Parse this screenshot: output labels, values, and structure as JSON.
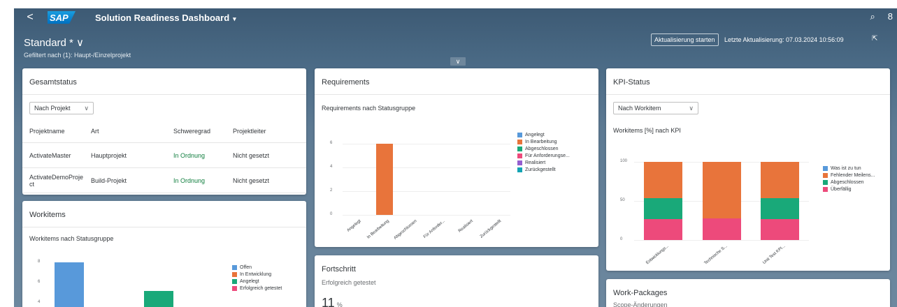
{
  "shell": {
    "back": "<",
    "logo": "SAP",
    "app_title": "Solution Readiness Dashboard",
    "app_caret": "▾",
    "search_icon": "⌕",
    "user_icon": "8"
  },
  "header": {
    "variant": "Standard * ∨",
    "filtered": "Gefiltert nach (1): Haupt-/Einzelprojekt",
    "refresh_label": "Aktualisierung starten",
    "last_update": "Letzte Aktualisierung: 07.03.2024 10:56:09",
    "external_icon": "⇱",
    "collapse_icon": "∨"
  },
  "gesamtstatus": {
    "title": "Gesamtstatus",
    "select": "Nach Projekt",
    "columns": [
      "Projektname",
      "Art",
      "Schweregrad",
      "Projektleiter"
    ],
    "rows": [
      [
        "ActivateMaster",
        "Hauptprojekt",
        "In Ordnung",
        "Nicht gesetzt"
      ],
      [
        "ActivateDemoProje ct",
        "Build-Projekt",
        "In Ordnung",
        "Nicht gesetzt"
      ]
    ]
  },
  "workitems": {
    "title": "Workitems",
    "subtitle": "Workitems nach Statusgruppe",
    "yticks": [
      "8",
      "6",
      "4"
    ],
    "legend": [
      "Offen",
      "In Entwicklung",
      "Angelegt",
      "Erfolgreich getestet"
    ]
  },
  "requirements": {
    "title": "Requirements",
    "subtitle": "Requirements nach Statusgruppe"
  },
  "fortschritt": {
    "title": "Fortschritt",
    "subtitle": "Erfolgreich getestet",
    "value": "11",
    "unit": "%"
  },
  "kpi": {
    "title": "KPI-Status",
    "select": "Nach Workitem",
    "subtitle": "Workitems [%] nach KPI"
  },
  "workpackages": {
    "title": "Work-Packages",
    "subtitle": "Scope-Änderungen"
  },
  "colors": {
    "blue": "#5899da",
    "orange": "#e8743b",
    "green": "#19a979",
    "pink": "#ed4a7b",
    "purple": "#945ecf",
    "teal": "#13a4b4"
  },
  "chart_data": [
    {
      "type": "bar",
      "title": "Requirements nach Statusgruppe",
      "categories": [
        "Angelegt",
        "In Bearbeitung",
        "Abgeschlossen",
        "Für Anforder...",
        "Realisiert",
        "Zurückgestellt"
      ],
      "values": [
        0,
        6,
        0,
        0,
        0,
        0
      ],
      "yticks": [
        "0",
        "2",
        "4",
        "6"
      ],
      "ylim": [
        0,
        6.5
      ],
      "legend": [
        "Angelegt",
        "In Bearbeitung",
        "Abgeschlossen",
        "Für Anforderungse...",
        "Realisiert",
        "Zurückgestellt"
      ],
      "legend_colors": [
        "#5899da",
        "#e8743b",
        "#19a979",
        "#ed4a7b",
        "#945ecf",
        "#13a4b4"
      ],
      "legend_position": "right"
    },
    {
      "type": "bar",
      "stacked": true,
      "title": "Workitems [%] nach KPI",
      "categories": [
        "Entwicklungs...",
        "Technische S...",
        "Unit Test KPI..."
      ],
      "yticks": [
        "0",
        "50",
        "100"
      ],
      "ylim": [
        0,
        100
      ],
      "series": [
        {
          "name": "Überfällig",
          "color": "#ed4a7b",
          "values": [
            27,
            28,
            27
          ]
        },
        {
          "name": "Abgeschlossen",
          "color": "#19a979",
          "values": [
            27,
            0,
            27
          ]
        },
        {
          "name": "Fehlender Meilens...",
          "color": "#e8743b",
          "values": [
            46,
            72,
            46
          ]
        },
        {
          "name": "Was ist zu tun",
          "color": "#5899da",
          "values": [
            0,
            0,
            0
          ]
        }
      ],
      "legend": [
        "Was ist zu tun",
        "Fehlender Meilens...",
        "Abgeschlossen",
        "Überfällig"
      ],
      "legend_colors": [
        "#5899da",
        "#e8743b",
        "#19a979",
        "#ed4a7b"
      ],
      "legend_position": "right"
    }
  ]
}
